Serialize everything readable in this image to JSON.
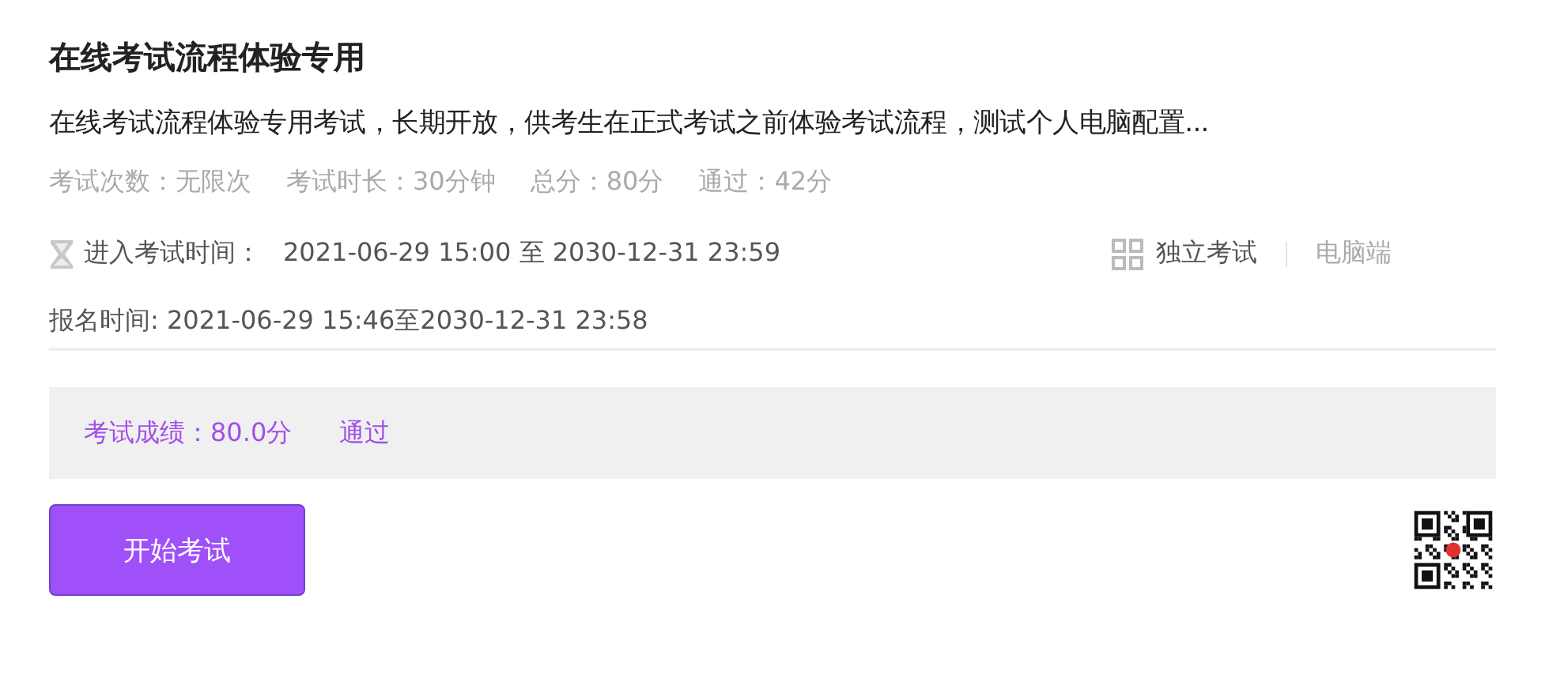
{
  "title": "在线考试流程体验专用",
  "description": "在线考试流程体验专用考试，长期开放，供考生在正式考试之前体验考试流程，测试个人电脑配置...",
  "stats": [
    "考试次数：无限次",
    "考试时长：30分钟",
    "总分：80分",
    "通过：42分"
  ],
  "entry_time": {
    "label": "进入考试时间：",
    "value": "2021-06-29 15:00 至 2030-12-31 23:59"
  },
  "tags": [
    "独立考试",
    "电脑端"
  ],
  "signup_time": "报名时间: 2021-06-29 15:46至2030-12-31 23:58",
  "result": {
    "score": "考试成绩：80.0分",
    "status": "通过"
  },
  "start_button": "开始考试"
}
